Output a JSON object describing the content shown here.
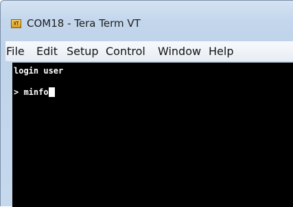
{
  "window": {
    "title": "COM18 - Tera Term VT",
    "icon_label": "VT",
    "icon_name": "tera-term-app-icon"
  },
  "menu": {
    "items": [
      {
        "label": "File"
      },
      {
        "label": "Edit"
      },
      {
        "label": "Setup"
      },
      {
        "label": "Control"
      },
      {
        "label": "Window"
      },
      {
        "label": "Help"
      }
    ]
  },
  "terminal": {
    "lines": [
      {
        "text": "login user"
      },
      {
        "text": "> minfo"
      }
    ],
    "colors": {
      "background": "#000000",
      "foreground": "#ffffff"
    }
  }
}
